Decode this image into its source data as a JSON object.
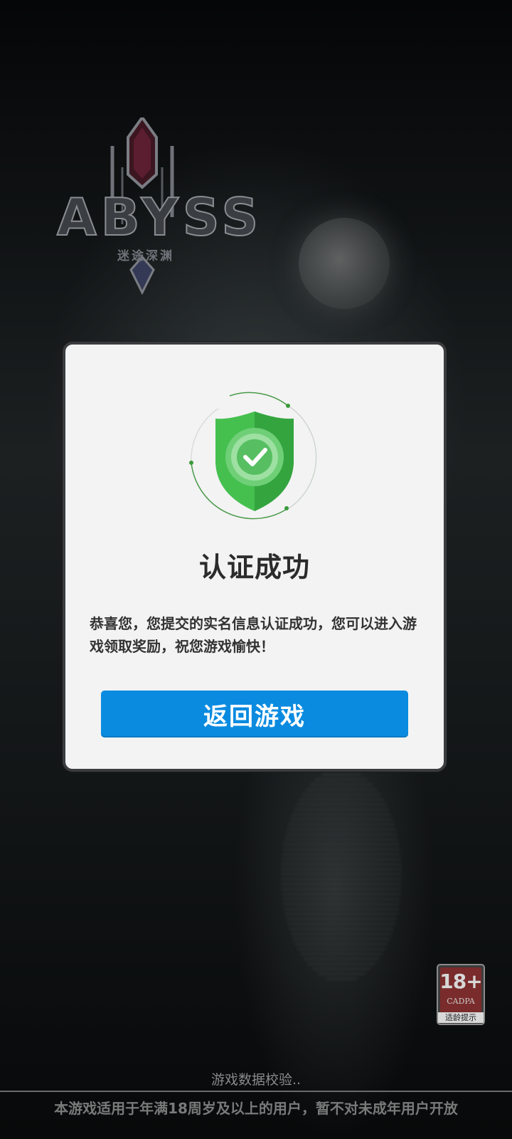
{
  "logo": {
    "wordmark": "ABYSS",
    "subtitle": "迷途深渊"
  },
  "dialog": {
    "title": "认证成功",
    "message": "恭喜您，您提交的实名信息认证成功，您可以进入游戏领取奖励，祝您游戏愉快！",
    "button_label": "返回游戏",
    "icon": "shield-check-icon",
    "colors": {
      "button": "#0a8be0",
      "shield": "#3cb44a"
    }
  },
  "age_badge": {
    "number": "18+",
    "org": "CADPA",
    "caption": "适龄提示"
  },
  "footer": {
    "status": "游戏数据校验..",
    "notice": "本游戏适用于年满18周岁及以上的用户，暂不对未成年用户开放"
  }
}
